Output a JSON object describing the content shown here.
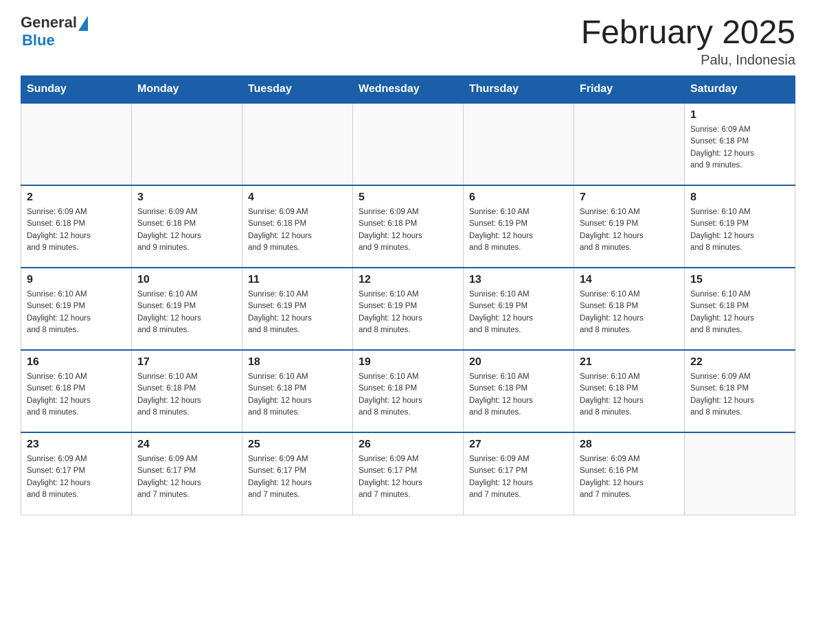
{
  "header": {
    "logo_general": "General",
    "logo_blue": "Blue",
    "title": "February 2025",
    "subtitle": "Palu, Indonesia"
  },
  "weekdays": [
    "Sunday",
    "Monday",
    "Tuesday",
    "Wednesday",
    "Thursday",
    "Friday",
    "Saturday"
  ],
  "weeks": [
    [
      {
        "day": "",
        "info": ""
      },
      {
        "day": "",
        "info": ""
      },
      {
        "day": "",
        "info": ""
      },
      {
        "day": "",
        "info": ""
      },
      {
        "day": "",
        "info": ""
      },
      {
        "day": "",
        "info": ""
      },
      {
        "day": "1",
        "info": "Sunrise: 6:09 AM\nSunset: 6:18 PM\nDaylight: 12 hours\nand 9 minutes."
      }
    ],
    [
      {
        "day": "2",
        "info": "Sunrise: 6:09 AM\nSunset: 6:18 PM\nDaylight: 12 hours\nand 9 minutes."
      },
      {
        "day": "3",
        "info": "Sunrise: 6:09 AM\nSunset: 6:18 PM\nDaylight: 12 hours\nand 9 minutes."
      },
      {
        "day": "4",
        "info": "Sunrise: 6:09 AM\nSunset: 6:18 PM\nDaylight: 12 hours\nand 9 minutes."
      },
      {
        "day": "5",
        "info": "Sunrise: 6:09 AM\nSunset: 6:18 PM\nDaylight: 12 hours\nand 9 minutes."
      },
      {
        "day": "6",
        "info": "Sunrise: 6:10 AM\nSunset: 6:19 PM\nDaylight: 12 hours\nand 8 minutes."
      },
      {
        "day": "7",
        "info": "Sunrise: 6:10 AM\nSunset: 6:19 PM\nDaylight: 12 hours\nand 8 minutes."
      },
      {
        "day": "8",
        "info": "Sunrise: 6:10 AM\nSunset: 6:19 PM\nDaylight: 12 hours\nand 8 minutes."
      }
    ],
    [
      {
        "day": "9",
        "info": "Sunrise: 6:10 AM\nSunset: 6:19 PM\nDaylight: 12 hours\nand 8 minutes."
      },
      {
        "day": "10",
        "info": "Sunrise: 6:10 AM\nSunset: 6:19 PM\nDaylight: 12 hours\nand 8 minutes."
      },
      {
        "day": "11",
        "info": "Sunrise: 6:10 AM\nSunset: 6:19 PM\nDaylight: 12 hours\nand 8 minutes."
      },
      {
        "day": "12",
        "info": "Sunrise: 6:10 AM\nSunset: 6:19 PM\nDaylight: 12 hours\nand 8 minutes."
      },
      {
        "day": "13",
        "info": "Sunrise: 6:10 AM\nSunset: 6:19 PM\nDaylight: 12 hours\nand 8 minutes."
      },
      {
        "day": "14",
        "info": "Sunrise: 6:10 AM\nSunset: 6:18 PM\nDaylight: 12 hours\nand 8 minutes."
      },
      {
        "day": "15",
        "info": "Sunrise: 6:10 AM\nSunset: 6:18 PM\nDaylight: 12 hours\nand 8 minutes."
      }
    ],
    [
      {
        "day": "16",
        "info": "Sunrise: 6:10 AM\nSunset: 6:18 PM\nDaylight: 12 hours\nand 8 minutes."
      },
      {
        "day": "17",
        "info": "Sunrise: 6:10 AM\nSunset: 6:18 PM\nDaylight: 12 hours\nand 8 minutes."
      },
      {
        "day": "18",
        "info": "Sunrise: 6:10 AM\nSunset: 6:18 PM\nDaylight: 12 hours\nand 8 minutes."
      },
      {
        "day": "19",
        "info": "Sunrise: 6:10 AM\nSunset: 6:18 PM\nDaylight: 12 hours\nand 8 minutes."
      },
      {
        "day": "20",
        "info": "Sunrise: 6:10 AM\nSunset: 6:18 PM\nDaylight: 12 hours\nand 8 minutes."
      },
      {
        "day": "21",
        "info": "Sunrise: 6:10 AM\nSunset: 6:18 PM\nDaylight: 12 hours\nand 8 minutes."
      },
      {
        "day": "22",
        "info": "Sunrise: 6:09 AM\nSunset: 6:18 PM\nDaylight: 12 hours\nand 8 minutes."
      }
    ],
    [
      {
        "day": "23",
        "info": "Sunrise: 6:09 AM\nSunset: 6:17 PM\nDaylight: 12 hours\nand 8 minutes."
      },
      {
        "day": "24",
        "info": "Sunrise: 6:09 AM\nSunset: 6:17 PM\nDaylight: 12 hours\nand 7 minutes."
      },
      {
        "day": "25",
        "info": "Sunrise: 6:09 AM\nSunset: 6:17 PM\nDaylight: 12 hours\nand 7 minutes."
      },
      {
        "day": "26",
        "info": "Sunrise: 6:09 AM\nSunset: 6:17 PM\nDaylight: 12 hours\nand 7 minutes."
      },
      {
        "day": "27",
        "info": "Sunrise: 6:09 AM\nSunset: 6:17 PM\nDaylight: 12 hours\nand 7 minutes."
      },
      {
        "day": "28",
        "info": "Sunrise: 6:09 AM\nSunset: 6:16 PM\nDaylight: 12 hours\nand 7 minutes."
      },
      {
        "day": "",
        "info": ""
      }
    ]
  ]
}
